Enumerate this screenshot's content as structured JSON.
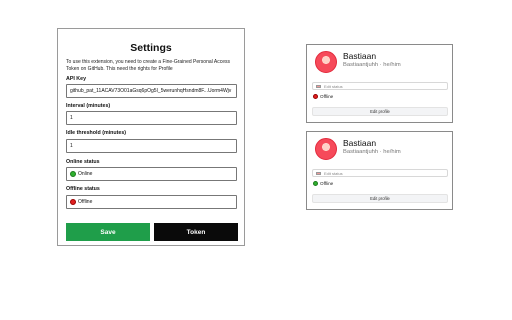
{
  "settings": {
    "title": "Settings",
    "description": "To use this extension, you need to create a Fine-Grained Personal Access Token on GitHub. This need the rights for Profile",
    "api_key_label": "API Key",
    "api_key_value": "github_pat_11ACAV73O01aGsq6pOg5I_5werunhqHsndm8F...Uorm4Wjv",
    "interval_label": "Interval (minutes)",
    "interval_value": "1",
    "idle_label": "Idle threshold (minutes)",
    "idle_value": "1",
    "online_label": "Online status",
    "online_value": "Online",
    "offline_label": "Offline status",
    "offline_value": "Offline",
    "save_label": "Save",
    "token_label": "Token"
  },
  "cards": [
    {
      "name": "Bastiaan",
      "username": "Bastiaantjuhh · he/him",
      "status_placeholder": "Edit status",
      "presence": "Offline",
      "presence_color": "#e02020",
      "edit_label": "Edit profile"
    },
    {
      "name": "Bastiaan",
      "username": "Bastiaantjuhh · he/him",
      "status_placeholder": "Edit status",
      "presence": "Offline",
      "presence_color": "#2fb02f",
      "edit_label": "Edit profile"
    }
  ],
  "colors": {
    "save": "#1f9e4a",
    "token": "#0a0a0a",
    "online": "#2fb02f",
    "offline": "#e02020"
  }
}
